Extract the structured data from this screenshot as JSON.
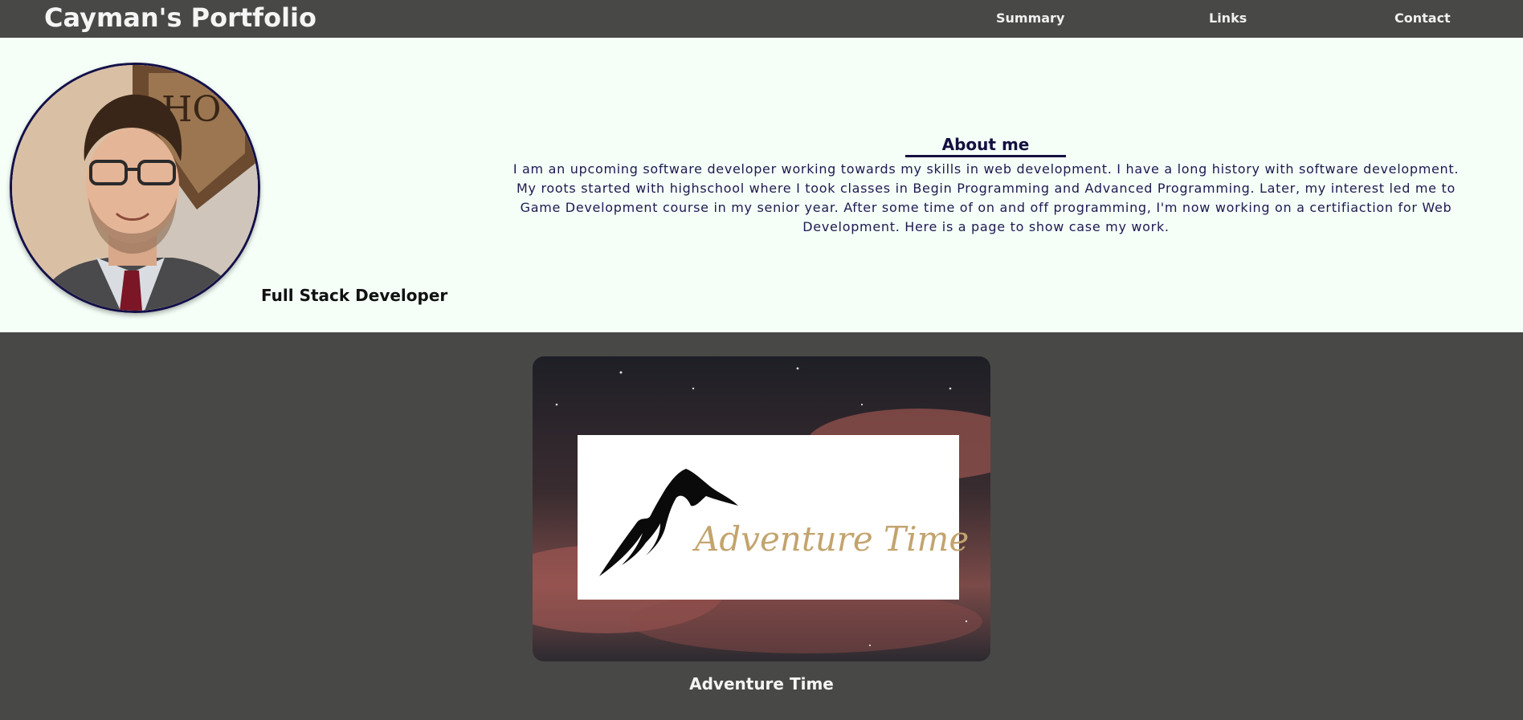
{
  "header": {
    "brand": "Cayman's Portfolio",
    "nav": [
      {
        "label": "Summary"
      },
      {
        "label": "Links"
      },
      {
        "label": "Contact"
      }
    ]
  },
  "profile": {
    "role": "Full Stack Developer",
    "about_title": "About me",
    "about_text": "I am an upcoming software developer working towards my skills in web development. I have a long history with software development. My roots started with highschool where I took classes in Begin Programming and Advanced Programming. Later, my interest led me to Game Development course in my senior year. After some time of on and off programming, I'm now working on a certifiaction for Web Development. Here is a page to show case my work."
  },
  "projects": [
    {
      "title": "Adventure Time",
      "logo_text": "Adventure Time"
    }
  ],
  "colors": {
    "nav_bg": "#484846",
    "hero_bg": "#f5fff8",
    "accent_navy": "#141040",
    "logo_gold": "#c3a46e"
  },
  "icons": {
    "avatar": "profile-photo",
    "logo": "mountain-logo-icon"
  }
}
